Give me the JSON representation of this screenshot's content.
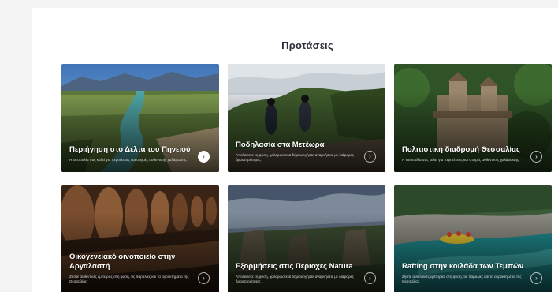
{
  "section": {
    "title": "Προτάσεις"
  },
  "cards": [
    {
      "title": "Περιήγηση στο Δέλτα του Πηνειού",
      "description": "Η Θεσσαλία σας καλεί για περιπέτειες και στιγμές αυθεντικής χαλάρωσης.",
      "arrow": "›",
      "arrow_style": "solid"
    },
    {
      "title": "Ποδηλασία στα Μετέωρα",
      "description": "Απολαύστε τη φύση, χαλαρώστε & δημιουργήστε αναμνήσεις με διάφορες δραστηριότητες.",
      "arrow": "›",
      "arrow_style": "outline"
    },
    {
      "title": "Πολιτιστική διαδρομή Θεσσαλίας",
      "description": "Η Θεσσαλία σας καλεί για περιπέτειες και στιγμές αυθεντικής χαλάρωσης.",
      "arrow": "›",
      "arrow_style": "outline"
    },
    {
      "title": "Οικογενειακό οινοποιείο στην Αργαλαστή",
      "description": "Ζήστε αυθεντικές εμπειρίες στη φύση, τις παραλίες και τα αγροκτήματα της Θεσσαλίας.",
      "arrow": "›",
      "arrow_style": "outline"
    },
    {
      "title": "Εξορμήσεις στις Περιοχές Natura",
      "description": "Απολαύστε τη φύση, χαλαρώστε & δημιουργήστε αναμνήσεις με διάφορες δραστηριότητες.",
      "arrow": "›",
      "arrow_style": "outline"
    },
    {
      "title": "Rafting στην κοιλάδα των Τεμπών",
      "description": "Ζήστε αυθεντικές εμπειρίες στη φύση, τις παραλίες και τα αγροκτήματα της Θεσσαλίας.",
      "arrow": "›",
      "arrow_style": "outline"
    }
  ]
}
